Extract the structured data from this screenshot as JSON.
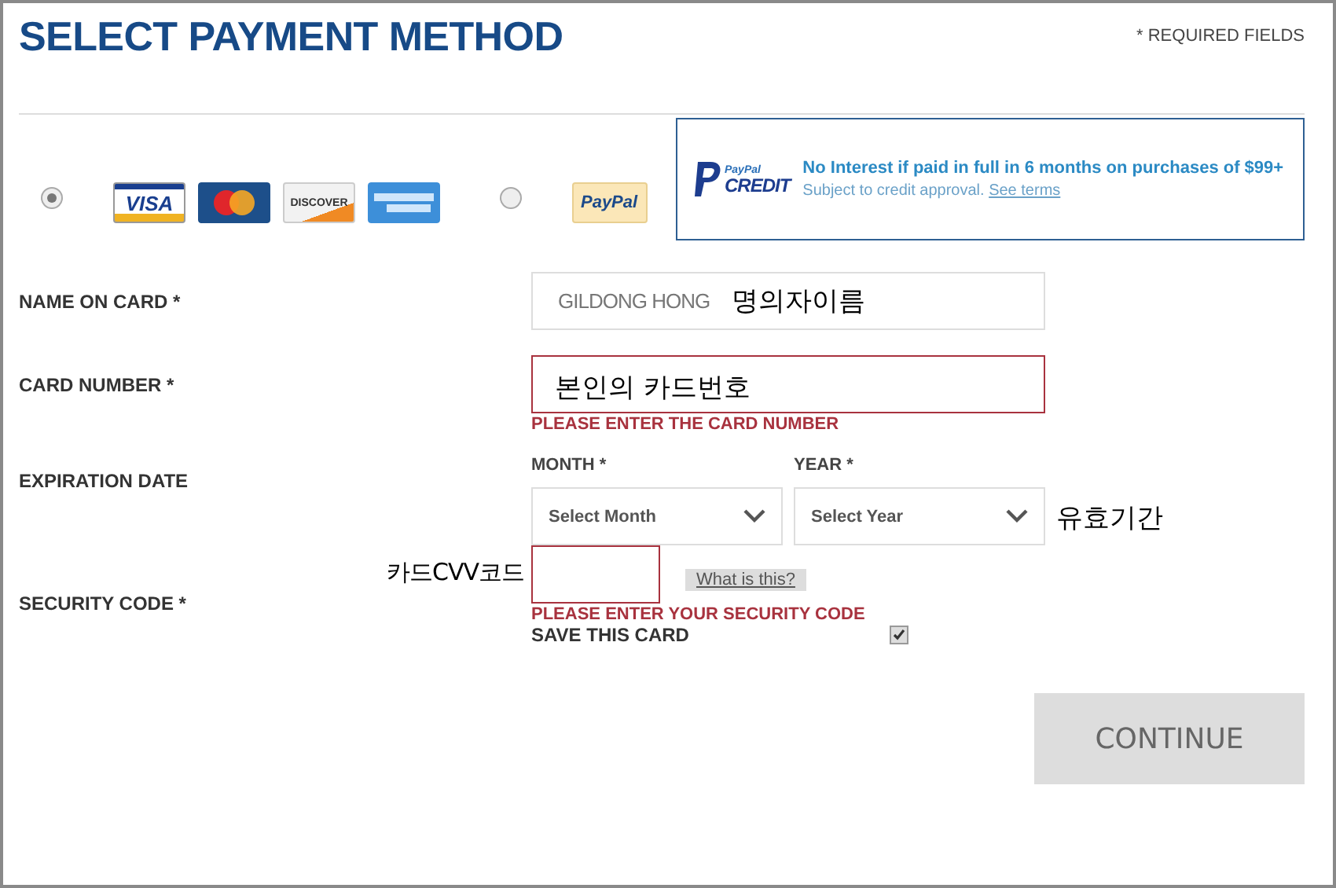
{
  "title": "SELECT PAYMENT METHOD",
  "required_note": "* REQUIRED FIELDS",
  "payment_options": [
    {
      "kind": "cards",
      "selected": true,
      "logos": [
        {
          "kind": "visa",
          "label": "VISA"
        },
        {
          "kind": "mastercard"
        },
        {
          "kind": "discover",
          "label": "DISCOVER"
        },
        {
          "kind": "amex"
        }
      ]
    },
    {
      "kind": "paypal",
      "selected": false,
      "logos": [
        {
          "kind": "paypal",
          "label": "PayPal"
        }
      ]
    }
  ],
  "promo": {
    "logo_top": "PayPal",
    "logo_bottom": "CREDIT",
    "headline": "No Interest if paid in full in 6 months on purchases of $99+",
    "note": "Subject to credit approval.",
    "link": "See terms"
  },
  "name_on_card": {
    "label": "NAME ON CARD *",
    "value": "GILDONG HONG",
    "annotation": "명의자이름"
  },
  "card_number": {
    "label": "CARD NUMBER *",
    "annotation": "본인의 카드번호",
    "error": "PLEASE ENTER THE CARD NUMBER"
  },
  "expiration": {
    "label": "EXPIRATION DATE",
    "month_label": "MONTH *",
    "month_value": "Select Month",
    "year_label": "YEAR *",
    "year_value": "Select Year",
    "annotation": "유효기간"
  },
  "security_code": {
    "label": "SECURITY CODE *",
    "annotation": "카드CVV코드",
    "help_link": "What is this?",
    "error": "PLEASE ENTER YOUR SECURITY CODE"
  },
  "save_card": {
    "label": "SAVE THIS CARD",
    "checked": true
  },
  "continue_button": "CONTINUE"
}
